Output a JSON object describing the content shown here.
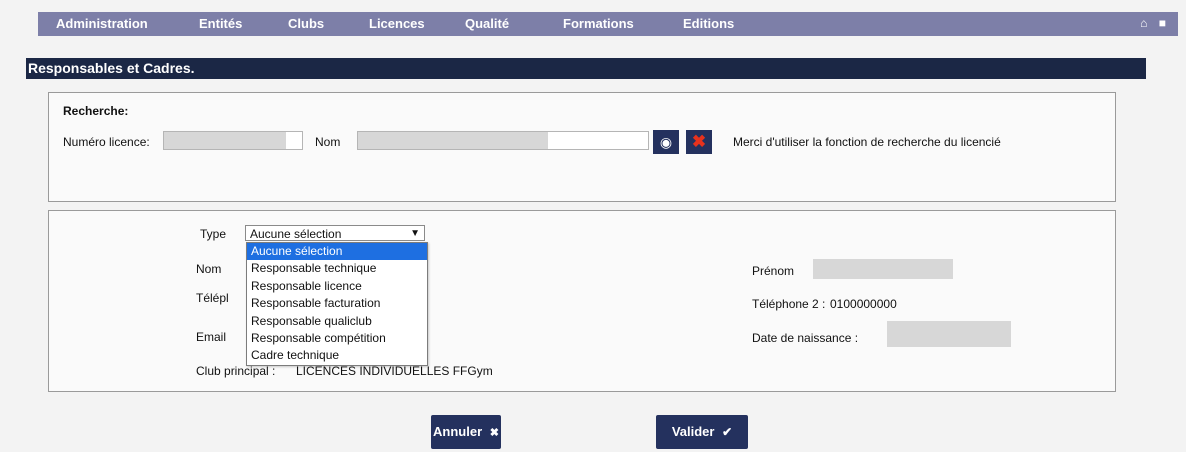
{
  "nav": {
    "items": [
      "Administration",
      "Entités",
      "Clubs",
      "Licences",
      "Qualité",
      "Formations",
      "Editions"
    ],
    "home_icon": "home-icon",
    "lock_icon": "lock-icon"
  },
  "page_title": "Responsables et Cadres.",
  "search": {
    "heading": "Recherche:",
    "licence_label": "Numéro licence:",
    "nom_label": "Nom",
    "hint": "Merci d'utiliser la fonction de recherche du licencié"
  },
  "form": {
    "type_label": "Type",
    "type_selected": "Aucune sélection",
    "type_options": [
      "Aucune sélection",
      "Responsable technique",
      "Responsable licence",
      "Responsable facturation",
      "Responsable qualiclub",
      "Responsable compétition",
      "Cadre technique"
    ],
    "nom_label": "Nom",
    "telephone_label": "Télépl",
    "email_label": "Email",
    "club_label": "Club principal :",
    "club_value": "LICENCES INDIVIDUELLES FFGym",
    "prenom_label": "Prénom",
    "telephone2_label": "Téléphone 2 :",
    "telephone2_value": "0100000000",
    "birth_label": "Date de naissance :"
  },
  "buttons": {
    "cancel": "Annuler",
    "cancel_icon": "✖",
    "validate": "Valider",
    "validate_icon": "✔"
  },
  "colors": {
    "nav_bg": "#7d7fa8",
    "title_bg": "#1b2745",
    "button_bg": "#24315e",
    "selected_option": "#1e6fe1",
    "clear_icon": "#e8321d"
  }
}
